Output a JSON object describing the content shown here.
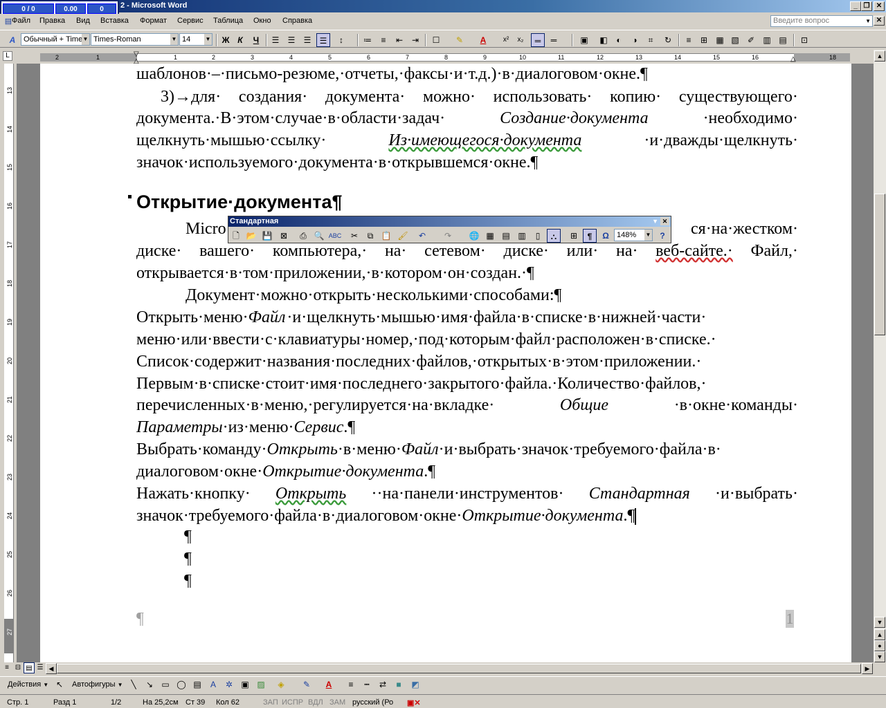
{
  "window": {
    "title": "2 - Microsoft Word",
    "perf": [
      "0 / 0",
      "0.00",
      "0"
    ]
  },
  "menu": [
    "Файл",
    "Правка",
    "Вид",
    "Вставка",
    "Формат",
    "Сервис",
    "Таблица",
    "Окно",
    "Справка"
  ],
  "ask_placeholder": "Введите вопрос",
  "format": {
    "style": "Обычный + Time",
    "font": "Times-Roman",
    "size": "14",
    "bold": "Ж",
    "italic": "К",
    "underline": "Ч"
  },
  "ruler_h": [
    "2",
    "1",
    "1",
    "2",
    "3",
    "4",
    "5",
    "6",
    "7",
    "8",
    "9",
    "10",
    "11",
    "12",
    "13",
    "14",
    "15",
    "16",
    "17",
    "18"
  ],
  "ruler_v": [
    "13",
    "14",
    "15",
    "16",
    "17",
    "18",
    "19",
    "20",
    "21",
    "22",
    "23",
    "24",
    "25",
    "26",
    "27"
  ],
  "doc": {
    "l1": "шаблонов·–·письмо-резюме,·отчеты,·факсы·и·т.д.)·в·диалоговом·окне.¶",
    "p3_num": "3)→для·",
    "p3_l1": [
      "3)→для·",
      "создания·",
      "документа·",
      "можно·",
      "использовать·",
      "копию·",
      "существующего·"
    ],
    "p3_l2a": "документа.·В·этом·случае·в·области·задач·",
    "p3_l2b": "Создание·документа",
    "p3_l2c": "·необходимо·",
    "p3_l3a": "щелкнуть·мышью·ссылку·",
    "p3_l3b": "Из·имеющегося·документа",
    "p3_l3c": "·и·дважды·щелкнуть·",
    "p3_l4": "значок·используемого·документа·в·открывшемся·окне.¶",
    "heading": "Открытие·документа¶",
    "m1a": "Micro",
    "m1b": "ся·на·жестком·",
    "m2": [
      "диске·",
      "вашего·",
      "компьютера,·",
      "на·",
      "сетевом·",
      "диске·",
      "или·",
      "на·",
      "веб-сайте.·",
      "Файл,·"
    ],
    "m3": "открывается·в·том·приложении,·в·котором·он·создан.·¶",
    "m4": "Документ·можно·открыть·несколькими·способами:¶",
    "o1a": "Открыть·меню·",
    "o1b": "Файл",
    "o1c": "·и·щелкнуть·мышью·имя·файла·в·списке·в·нижней·части·",
    "o2": "меню·или·ввести·с·клавиатуры·номер,·под·которым·файл·расположен·в·списке.·",
    "o3": "Список·содержит·названия·последних·файлов,·открытых·в·этом·приложении.·",
    "o4": "Первым·в·списке·стоит·имя·последнего·закрытого·файла.·Количество·файлов,·",
    "o5a": "перечисленных·в·меню,·регулируется·на·вкладке·",
    "o5b": "Общие",
    "o5c": "·в·окне·команды·",
    "o6a": "Параметры",
    "o6b": "·из·меню·",
    "o6c": "Сервис",
    "o6d": ".¶",
    "v1a": "Выбрать·команду·",
    "v1b": "Открыть",
    "v1c": "·в·меню·",
    "v1d": "Файл",
    "v1e": "·и·выбрать·значок·требуемого·файла·в·",
    "v2a": "диалоговом·окне·",
    "v2b": "Открытие·документа",
    "v2c": ".¶",
    "n1a": "Нажать·кнопку·",
    "n1b": "Открыть",
    "n1c": "··на·панели·инструментов·",
    "n1d": "Стандартная",
    "n1e": "·и·выбрать·",
    "n2a": "значок·требуемого·файла·в·диалоговом·окне·",
    "n2b": "Открытие·документа",
    "n2c": ".¶",
    "pilcrow": "¶",
    "page_num": "1"
  },
  "float_toolbar": {
    "title": "Стандартная",
    "zoom": "148%"
  },
  "drawing": {
    "actions": "Действия",
    "autoshapes": "Автофигуры"
  },
  "status": {
    "page": "Стр. 1",
    "section": "Разд 1",
    "pages": "1/2",
    "at": "На 25,2см",
    "line": "Ст 39",
    "col": "Кол 62",
    "rec": "ЗАП",
    "trk": "ИСПР",
    "ext": "ВДЛ",
    "ovr": "ЗАМ",
    "lang": "русский (Ро"
  }
}
